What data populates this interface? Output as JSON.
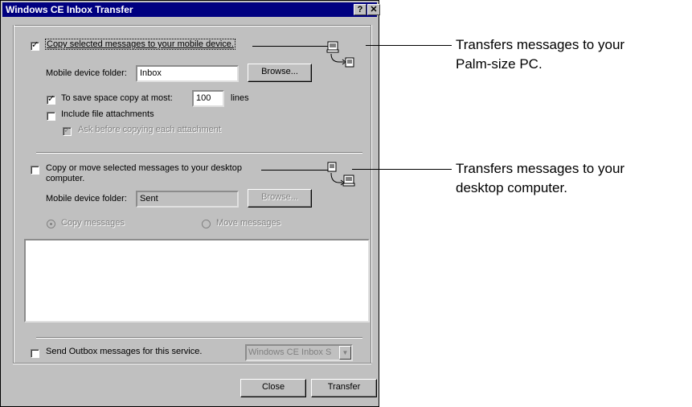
{
  "window": {
    "title": "Windows CE Inbox Transfer",
    "help_btn": "?",
    "close_btn": "✕"
  },
  "mobile_section": {
    "checkbox_label": "Copy selected messages to your mobile device.",
    "checked": true,
    "folder_label": "Mobile device folder:",
    "folder_value": "Inbox",
    "browse_label": "Browse...",
    "save_space_label": "To save space copy at most:",
    "save_space_checked": true,
    "lines_value": "100",
    "lines_label": "lines",
    "attachments_label": "Include file attachments",
    "attachments_checked": false,
    "ask_label": "Ask before copying each attachment",
    "ask_checked": true
  },
  "desktop_section": {
    "checkbox_label_line1": "Copy or move selected messages to your desktop",
    "checkbox_label_line2": "computer.",
    "checked": false,
    "folder_label": "Mobile device folder:",
    "folder_value": "Sent",
    "browse_label": "Browse...",
    "copy_radio_label": "Copy messages",
    "move_radio_label": "Move messages"
  },
  "outbox": {
    "checkbox_label": "Send Outbox messages for this service.",
    "checked": false,
    "service_value": "Windows CE Inbox S"
  },
  "buttons": {
    "close": "Close",
    "transfer": "Transfer"
  },
  "callouts": {
    "mobile_line1": "Transfers messages to your",
    "mobile_line2": "Palm-size PC.",
    "desktop_line1": "Transfers messages to your",
    "desktop_line2": "desktop computer."
  }
}
